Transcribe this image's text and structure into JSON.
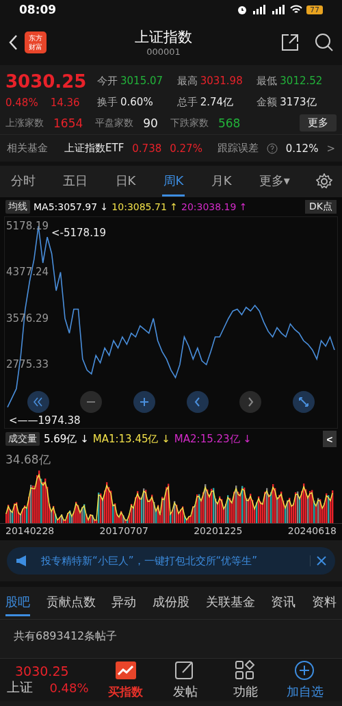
{
  "status_bar": {
    "time": "08:09",
    "battery": "77"
  },
  "header": {
    "title": "上证指数",
    "code": "000001",
    "logo_text": [
      "东方",
      "财富"
    ]
  },
  "quote": {
    "price": "3030.25",
    "change_pct": "0.48%",
    "change": "14.36",
    "stats": [
      {
        "label": "今开",
        "value": "3015.07",
        "color": "#22b33a"
      },
      {
        "label": "最高",
        "value": "3031.98",
        "color": "#e8222a"
      },
      {
        "label": "最低",
        "value": "3012.52",
        "color": "#22b33a"
      },
      {
        "label": "换手",
        "value": "0.60%",
        "color": "#eeeeee"
      },
      {
        "label": "总手",
        "value": "2.74亿",
        "color": "#eeeeee"
      },
      {
        "label": "金额",
        "value": "3173亿",
        "color": "#eeeeee"
      }
    ],
    "breadth": [
      {
        "label": "上涨家数",
        "value": "1654",
        "color": "#e8222a"
      },
      {
        "label": "平盘家数",
        "value": "90",
        "color": "#eeeeee"
      },
      {
        "label": "下跌家数",
        "value": "568",
        "color": "#22b33a"
      }
    ],
    "more_button": "更多"
  },
  "fund_row": {
    "label": "相关基金",
    "fund": "上证指数ETF",
    "price": "0.738",
    "pct": "0.27%",
    "error_label": "跟踪误差",
    "error_value": "0.12%",
    "arrow": ">"
  },
  "chart_tabs": [
    {
      "label": "分时",
      "selected": false
    },
    {
      "label": "五日",
      "selected": false
    },
    {
      "label": "日K",
      "selected": false
    },
    {
      "label": "周K",
      "selected": true
    },
    {
      "label": "月K",
      "selected": false
    },
    {
      "label": "更多▾",
      "selected": false
    }
  ],
  "ma_bar": {
    "selector": "均线",
    "items": [
      {
        "text": "MA5:3057.97 ↓",
        "color": "#ffffff"
      },
      {
        "text": "10:3085.71 ↑",
        "color": "#f2e14a"
      },
      {
        "text": "20:3038.19 ↑",
        "color": "#d42bc9"
      }
    ],
    "dk_button": "DK点"
  },
  "price_chart": {
    "high_marker": "<-5178.19",
    "low_marker": "<——1974.38",
    "chart_data": {
      "type": "line",
      "ylim": [
        1654,
        5332
      ],
      "yticks": [
        {
          "value": 5178.19,
          "label": "5178.19"
        },
        {
          "value": 4377.24,
          "label": "4377.24"
        },
        {
          "value": 3576.29,
          "label": "3576.29"
        },
        {
          "value": 2775.33,
          "label": "2775.33"
        }
      ],
      "categories": [
        null,
        null,
        null,
        null,
        null,
        null,
        null,
        null,
        null,
        null,
        null,
        null,
        null,
        null,
        null,
        null,
        null,
        null,
        null,
        null,
        null,
        null,
        null,
        null,
        null,
        null,
        null,
        null,
        null,
        null,
        null,
        null,
        null,
        null,
        null,
        null,
        null,
        null,
        null,
        null,
        null,
        null,
        null,
        null,
        null,
        null,
        null,
        null,
        null,
        null,
        null,
        null,
        null,
        null,
        null,
        null,
        null,
        null,
        null,
        null,
        null,
        null,
        null,
        null,
        null,
        null,
        null,
        null,
        null,
        null,
        null,
        null,
        null,
        null,
        null
      ],
      "series": [
        {
          "color": "#4a8fdc",
          "values": [
            2038,
            2198,
            2358,
            2935,
            3736,
            4217,
            4601,
            5178,
            4537,
            4986,
            4697,
            4057,
            4377,
            3576,
            3320,
            3736,
            3736,
            2871,
            2679,
            2615,
            2935,
            2807,
            3063,
            2935,
            3191,
            3063,
            3256,
            3128,
            3320,
            3256,
            3448,
            3384,
            3320,
            3576,
            3191,
            2999,
            2871,
            2679,
            2551,
            2775,
            3256,
            3095,
            2871,
            3063,
            2839,
            2775,
            2999,
            3256,
            3256,
            3416,
            3576,
            3704,
            3736,
            3640,
            3768,
            3704,
            3800,
            3704,
            3512,
            3352,
            3256,
            3416,
            3320,
            3256,
            3480,
            3384,
            3320,
            3191,
            3128,
            3031,
            2871,
            3191,
            3095,
            3256,
            3030
          ]
        }
      ]
    }
  },
  "volume_bar": {
    "selector": "成交量",
    "items": [
      {
        "text": "5.69亿 ↓",
        "color": "#ffffff"
      },
      {
        "text": "MA1:13.45亿 ↓",
        "color": "#f2e14a"
      },
      {
        "text": "MA2:15.23亿 ↓",
        "color": "#d42bc9"
      }
    ],
    "collapse": "<"
  },
  "volume_chart": {
    "y_label": "34.68亿",
    "dates": [
      "20140228",
      "20170707",
      "20201225",
      "20240618"
    ]
  },
  "banner": {
    "text": "投专精特新“小巨人”，一键打包北交所“优等生”"
  },
  "content_tabs": [
    {
      "label": "股吧",
      "selected": true
    },
    {
      "label": "贡献点数",
      "selected": false
    },
    {
      "label": "异动",
      "selected": false
    },
    {
      "label": "成份股",
      "selected": false
    },
    {
      "label": "关联基金",
      "selected": false
    },
    {
      "label": "资讯",
      "selected": false
    },
    {
      "label": "资料",
      "selected": false
    }
  ],
  "post_count": "共有6893412条帖子",
  "bottom_nav": {
    "index_name": "上证",
    "price": "3030.25",
    "pct": "0.48%",
    "items": [
      {
        "label": "买指数",
        "kind": "promo"
      },
      {
        "label": "发帖",
        "kind": "post"
      },
      {
        "label": "功能",
        "kind": "grid"
      },
      {
        "label": "加自选",
        "kind": "add"
      }
    ]
  }
}
